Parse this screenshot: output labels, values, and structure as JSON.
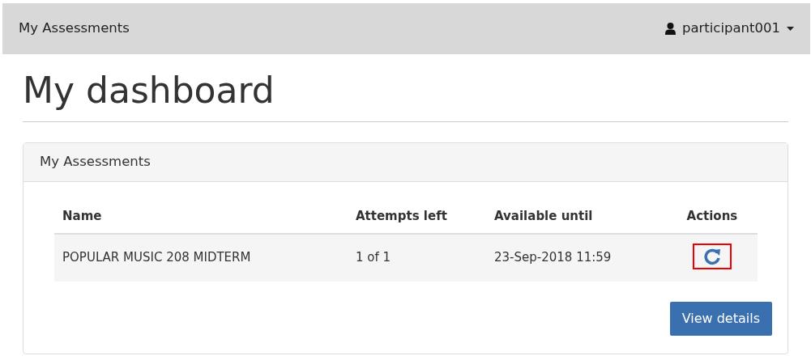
{
  "navbar": {
    "brand": "My Assessments",
    "user": "participant001"
  },
  "page": {
    "title": "My dashboard"
  },
  "panel": {
    "title": "My Assessments",
    "table": {
      "columns": [
        "Name",
        "Attempts left",
        "Available until",
        "Actions"
      ],
      "rows": [
        {
          "name": "POPULAR MUSIC 208 MIDTERM",
          "attempts_left": "1 of 1",
          "available_until": "23-Sep-2018 11:59",
          "action_highlighted": true
        }
      ]
    },
    "button": "View details"
  }
}
